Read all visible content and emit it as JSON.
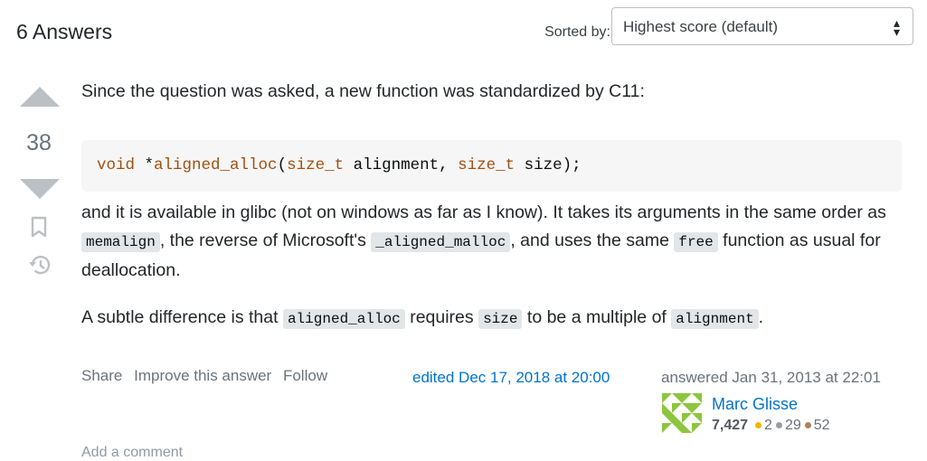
{
  "header": {
    "answers_count": "6 Answers",
    "sorted_label": "Sorted by:",
    "sort_value": "Highest score (default)"
  },
  "vote": {
    "score": "38"
  },
  "post": {
    "p1": "Since the question was asked, a new function was standardized by C11:",
    "code": {
      "kw_void": "void",
      "star": " *",
      "fn_name": "aligned_alloc",
      "open": "(",
      "type1": "size_t",
      "arg1": " alignment, ",
      "type2": "size_t",
      "arg2": " size);"
    },
    "p2": {
      "t1": "and it is available in glibc (not on windows as far as I know). It takes its arguments in the same order as ",
      "c1": "memalign",
      "t2": ", the reverse of Microsoft's ",
      "c2": "_aligned_malloc",
      "t3": ", and uses the same ",
      "c3": "free",
      "t4": " function as usual for deallocation."
    },
    "p3": {
      "t1": "A subtle difference is that ",
      "c1": "aligned_alloc",
      "t2": " requires ",
      "c2": "size",
      "t3": " to be a multiple of ",
      "c3": "alignment",
      "t4": "."
    }
  },
  "menu": {
    "share": "Share",
    "improve": "Improve this answer",
    "follow": "Follow"
  },
  "edited": "edited Dec 17, 2018 at 20:00",
  "answered": "answered Jan 31, 2013 at 22:01",
  "user": {
    "name": "Marc Glisse",
    "reputation": "7,427",
    "gold": "2",
    "silver": "29",
    "bronze": "52",
    "gold_color": "#f1b600",
    "silver_color": "#9a9c9f",
    "bronze_color": "#ab8259",
    "avatar_color": "#8cc63e"
  },
  "add_comment": "Add a comment"
}
